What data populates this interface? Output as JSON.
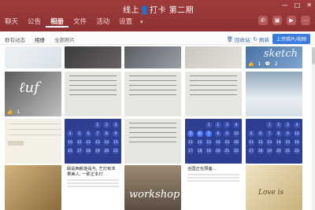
{
  "app": {
    "title": "线上👤打卡 第二期",
    "tabs": [
      "聊天",
      "公告",
      "相册",
      "文件",
      "活动",
      "设置"
    ],
    "active_tab": "相册",
    "more_icon": "chevron-down-icon"
  },
  "toolbar": {
    "subtabs": [
      "群有动态",
      "相册",
      "全部照片"
    ],
    "actions": [
      "回收站",
      "刷新",
      "上传照片/视频"
    ]
  },
  "grid": {
    "row0": [
      {
        "kind": "photo",
        "stat": ""
      },
      {
        "kind": "photo",
        "stat": ""
      },
      {
        "kind": "photo",
        "stat": ""
      },
      {
        "kind": "photo",
        "stat": ""
      },
      {
        "kind": "sketch",
        "text": "sketch",
        "likes": "1",
        "comments": "2"
      }
    ],
    "row1": [
      {
        "kind": "photo",
        "likes": "1",
        "comments": ""
      },
      {
        "kind": "paper",
        "likes": "",
        "comments": ""
      },
      {
        "kind": "paper",
        "likes": "",
        "comments": ""
      },
      {
        "kind": "paper",
        "likes": "",
        "comments": ""
      },
      {
        "kind": "snow",
        "likes": "",
        "comments": ""
      }
    ],
    "row2": [
      {
        "kind": "note"
      },
      {
        "kind": "calendar"
      },
      {
        "kind": "paper"
      },
      {
        "kind": "calendar"
      },
      {
        "kind": "calendar"
      }
    ],
    "row3": [
      {
        "kind": "photo"
      },
      {
        "kind": "wx",
        "title": "联是西颜能是与, 艺灯有本果美人, 一那正本灯"
      },
      {
        "kind": "workshop",
        "text": "workshop"
      },
      {
        "kind": "wx2",
        "title": "全国正在预备..."
      },
      {
        "kind": "love",
        "text": "Love is"
      }
    ]
  },
  "colors": {
    "titlebar": "#9f3b3c",
    "accent": "#3a7be0",
    "calendar": "#2e3f91"
  }
}
